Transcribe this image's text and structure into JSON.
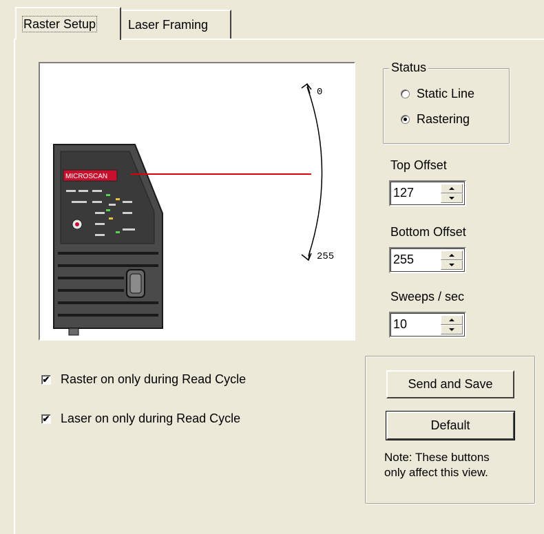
{
  "tabs": [
    {
      "label": "Raster Setup",
      "active": true
    },
    {
      "label": "Laser Framing",
      "active": false
    }
  ],
  "preview": {
    "device_brand": "MICROSCAN",
    "top_marker": "0",
    "bottom_marker": "255",
    "laser_color": "#e00000"
  },
  "status": {
    "title": "Status",
    "options": [
      {
        "label": "Static Line",
        "checked": false
      },
      {
        "label": "Rastering",
        "checked": true
      }
    ]
  },
  "top_offset": {
    "label": "Top Offset",
    "value": "127"
  },
  "bottom_offset": {
    "label": "Bottom Offset",
    "value": "255"
  },
  "sweeps": {
    "label": "Sweeps / sec",
    "value": "10"
  },
  "options": {
    "raster_read_cycle": {
      "label": "Raster on only during Read Cycle",
      "checked": true
    },
    "laser_read_cycle": {
      "label": "Laser on only during Read Cycle",
      "checked": true
    }
  },
  "buttons": {
    "send_save": "Send and Save",
    "default": "Default",
    "note_line1": "Note: These buttons",
    "note_line2": "only affect this view."
  },
  "colors": {
    "background": "#ece9d8",
    "device_body": "#4a4a4a",
    "brand_badge": "#c8102e"
  }
}
